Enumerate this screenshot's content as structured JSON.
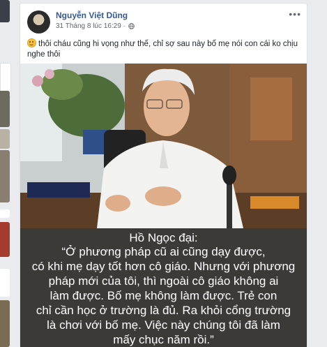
{
  "post": {
    "author": "Nguyễn Việt Dũng",
    "timestamp": "31 Tháng 8 lúc 16:29 ·",
    "privacy_icon": "globe-icon",
    "status_text": "thôi cháu cũng hi vọng như thế, chỉ sợ sau này bố mẹ nói con cái ko chịu nghe thôi",
    "status_emoji": "smiling-face-icon"
  },
  "image": {
    "caption_lines": [
      "Hồ Ngọc đại:",
      "“Ở phương pháp cũ ai cũng dạy được,",
      "có khi mẹ dạy tốt hơn cô giáo. Nhưng với phương",
      "pháp mới của tôi, thì ngoài cô giáo không ai",
      "làm được. Bố mẹ không làm được. Trẻ con",
      "chỉ cần học ở trường là đủ. Ra khỏi cổng trường",
      "là chơi với bố mẹ. Việc này chúng tôi đã làm",
      "mấy chục năm rồi.”"
    ]
  }
}
